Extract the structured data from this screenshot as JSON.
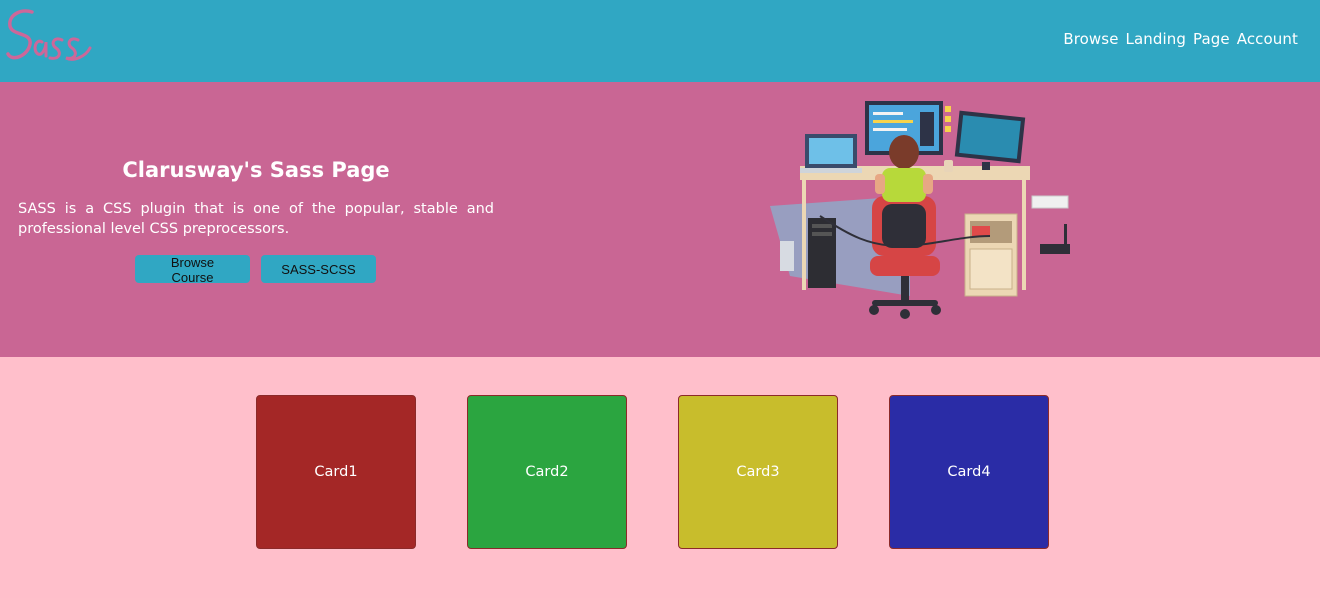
{
  "header": {
    "logo_text": "Sass",
    "logo_color": "#cd6799",
    "nav": [
      "Browse",
      "Landing",
      "Page",
      "Account"
    ]
  },
  "hero": {
    "title": "Clarusway's Sass Page",
    "text": "SASS is a CSS plugin that is one of the popular, stable and professional level CSS preprocessors.",
    "buttons": [
      "Browse Course",
      "SASS-SCSS"
    ],
    "illustration": "developer-at-desk-icon"
  },
  "cards": [
    {
      "label": "Card1",
      "color": "#a42726"
    },
    {
      "label": "Card2",
      "color": "#2ba540"
    },
    {
      "label": "Card3",
      "color": "#c8bd2c"
    },
    {
      "label": "Card4",
      "color": "#2a2ca6"
    }
  ],
  "colors": {
    "header_bg": "#30a7c3",
    "hero_bg": "#c96694",
    "page_bg": "#ffbfcb",
    "button_bg": "#30a7c3"
  }
}
